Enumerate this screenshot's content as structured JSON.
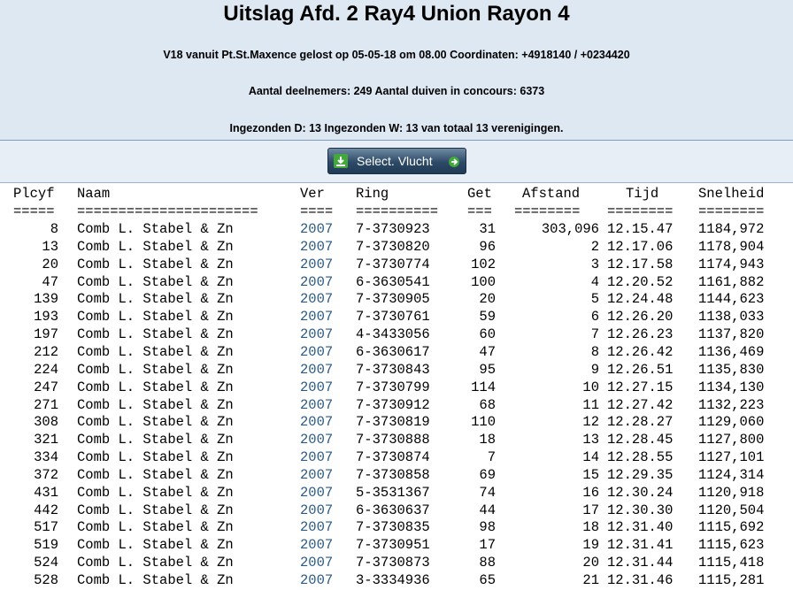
{
  "header": {
    "title": "Uitslag Afd. 2 Ray4 Union Rayon 4",
    "line1": "V18 vanuit Pt.St.Maxence gelost op 05-05-18 om 08.00 Coordinaten: +4918140 / +0234420",
    "line2": "Aantal deelnemers: 249 Aantal duiven in concours: 6373",
    "line3": "Ingezonden D: 13 Ingezonden W: 13 van totaal 13 verenigingen."
  },
  "button": {
    "label": "Select. Vlucht"
  },
  "table": {
    "columns": [
      "Plcyf",
      "Naam",
      "Ver",
      "Ring",
      "Get",
      "Afstand",
      "Tijd",
      "Snelheid"
    ],
    "underlines": [
      "=====",
      "======================",
      "====",
      "==========",
      "===",
      "========",
      "========",
      "========"
    ],
    "rows": [
      {
        "plc": "8",
        "naam": "Comb L. Stabel & Zn",
        "ver": "2007",
        "ring": "7-3730923",
        "get": "31",
        "afs": "303,096",
        "tijd": "12.15.47",
        "snel": "1184,972"
      },
      {
        "plc": "13",
        "naam": "Comb L. Stabel & Zn",
        "ver": "2007",
        "ring": "7-3730820",
        "get": "96",
        "afs": "2",
        "tijd": "12.17.06",
        "snel": "1178,904"
      },
      {
        "plc": "20",
        "naam": "Comb L. Stabel & Zn",
        "ver": "2007",
        "ring": "7-3730774",
        "get": "102",
        "afs": "3",
        "tijd": "12.17.58",
        "snel": "1174,943"
      },
      {
        "plc": "47",
        "naam": "Comb L. Stabel & Zn",
        "ver": "2007",
        "ring": "6-3630541",
        "get": "100",
        "afs": "4",
        "tijd": "12.20.52",
        "snel": "1161,882"
      },
      {
        "plc": "139",
        "naam": "Comb L. Stabel & Zn",
        "ver": "2007",
        "ring": "7-3730905",
        "get": "20",
        "afs": "5",
        "tijd": "12.24.48",
        "snel": "1144,623"
      },
      {
        "plc": "193",
        "naam": "Comb L. Stabel & Zn",
        "ver": "2007",
        "ring": "7-3730761",
        "get": "59",
        "afs": "6",
        "tijd": "12.26.20",
        "snel": "1138,033"
      },
      {
        "plc": "197",
        "naam": "Comb L. Stabel & Zn",
        "ver": "2007",
        "ring": "4-3433056",
        "get": "60",
        "afs": "7",
        "tijd": "12.26.23",
        "snel": "1137,820"
      },
      {
        "plc": "212",
        "naam": "Comb L. Stabel & Zn",
        "ver": "2007",
        "ring": "6-3630617",
        "get": "47",
        "afs": "8",
        "tijd": "12.26.42",
        "snel": "1136,469"
      },
      {
        "plc": "224",
        "naam": "Comb L. Stabel & Zn",
        "ver": "2007",
        "ring": "7-3730843",
        "get": "95",
        "afs": "9",
        "tijd": "12.26.51",
        "snel": "1135,830"
      },
      {
        "plc": "247",
        "naam": "Comb L. Stabel & Zn",
        "ver": "2007",
        "ring": "7-3730799",
        "get": "114",
        "afs": "10",
        "tijd": "12.27.15",
        "snel": "1134,130"
      },
      {
        "plc": "271",
        "naam": "Comb L. Stabel & Zn",
        "ver": "2007",
        "ring": "7-3730912",
        "get": "68",
        "afs": "11",
        "tijd": "12.27.42",
        "snel": "1132,223"
      },
      {
        "plc": "308",
        "naam": "Comb L. Stabel & Zn",
        "ver": "2007",
        "ring": "7-3730819",
        "get": "110",
        "afs": "12",
        "tijd": "12.28.27",
        "snel": "1129,060"
      },
      {
        "plc": "321",
        "naam": "Comb L. Stabel & Zn",
        "ver": "2007",
        "ring": "7-3730888",
        "get": "18",
        "afs": "13",
        "tijd": "12.28.45",
        "snel": "1127,800"
      },
      {
        "plc": "334",
        "naam": "Comb L. Stabel & Zn",
        "ver": "2007",
        "ring": "7-3730874",
        "get": "7",
        "afs": "14",
        "tijd": "12.28.55",
        "snel": "1127,101"
      },
      {
        "plc": "372",
        "naam": "Comb L. Stabel & Zn",
        "ver": "2007",
        "ring": "7-3730858",
        "get": "69",
        "afs": "15",
        "tijd": "12.29.35",
        "snel": "1124,314"
      },
      {
        "plc": "431",
        "naam": "Comb L. Stabel & Zn",
        "ver": "2007",
        "ring": "5-3531367",
        "get": "74",
        "afs": "16",
        "tijd": "12.30.24",
        "snel": "1120,918"
      },
      {
        "plc": "442",
        "naam": "Comb L. Stabel & Zn",
        "ver": "2007",
        "ring": "6-3630637",
        "get": "44",
        "afs": "17",
        "tijd": "12.30.30",
        "snel": "1120,504"
      },
      {
        "plc": "517",
        "naam": "Comb L. Stabel & Zn",
        "ver": "2007",
        "ring": "7-3730835",
        "get": "98",
        "afs": "18",
        "tijd": "12.31.40",
        "snel": "1115,692"
      },
      {
        "plc": "519",
        "naam": "Comb L. Stabel & Zn",
        "ver": "2007",
        "ring": "7-3730951",
        "get": "17",
        "afs": "19",
        "tijd": "12.31.41",
        "snel": "1115,623"
      },
      {
        "plc": "524",
        "naam": "Comb L. Stabel & Zn",
        "ver": "2007",
        "ring": "7-3730873",
        "get": "88",
        "afs": "20",
        "tijd": "12.31.44",
        "snel": "1115,418"
      },
      {
        "plc": "528",
        "naam": "Comb L. Stabel & Zn",
        "ver": "2007",
        "ring": "3-3334936",
        "get": "65",
        "afs": "21",
        "tijd": "12.31.46",
        "snel": "1115,281"
      }
    ]
  }
}
